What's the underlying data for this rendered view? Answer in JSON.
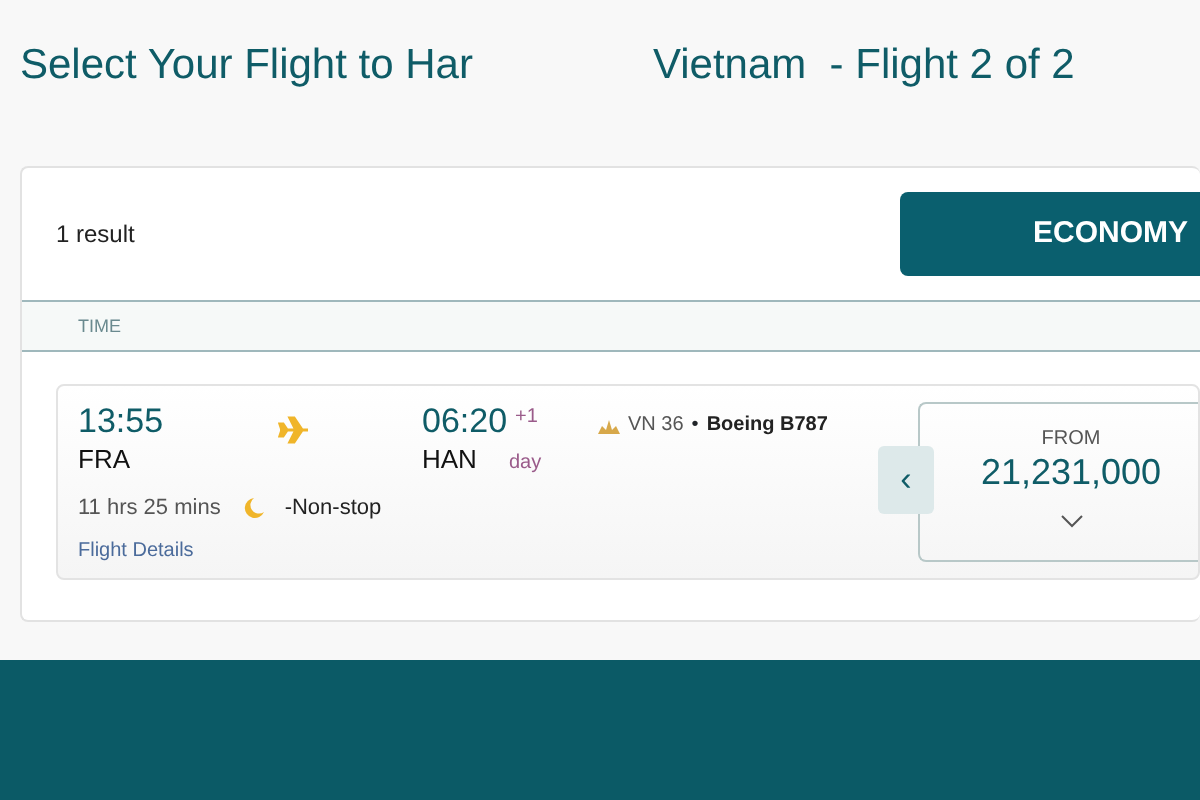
{
  "title_parts": [
    "Select Your Flight to Har",
    "Vietnam  - Flight 2 of 2"
  ],
  "results": {
    "count": "1 result",
    "cabin_button": "ECONOMY"
  },
  "columns": [
    "TIME"
  ],
  "flight": {
    "depart_time": "13:55",
    "depart_airport": "FRA",
    "arrive_time": "06:20",
    "day_offset": "+1",
    "day_label": "day",
    "arrive_airport": "HAN",
    "flight_number": "VN 36",
    "separator": "•",
    "aircraft": "Boeing B787",
    "prev_arrow": "‹",
    "duration": "11 hrs 25 mins",
    "stops": "-Non-stop",
    "details_link": "Flight Details",
    "fare_label": "FROM",
    "price": "21,231,000"
  }
}
